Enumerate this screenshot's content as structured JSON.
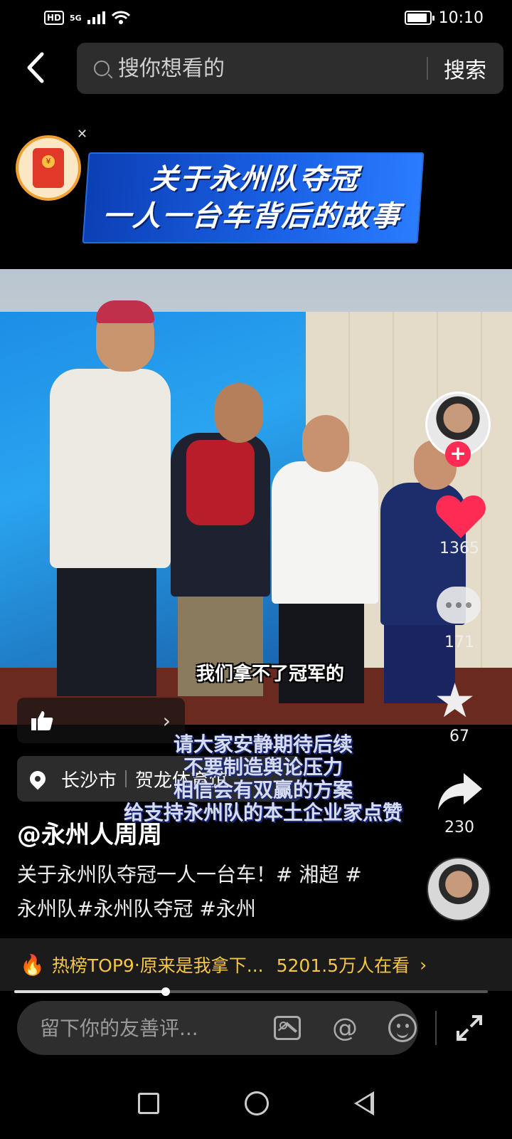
{
  "status_bar": {
    "hd": "HD",
    "network": "5G",
    "time": "10:10",
    "battery_level": 0.9
  },
  "search": {
    "placeholder": "搜你想看的",
    "button_label": "搜索"
  },
  "banner": {
    "line1": "关于永州队夺冠",
    "line2": "一人一台车背后的故事"
  },
  "video": {
    "subtitle_main": "我们拿不了冠军的",
    "subtitle_lines": [
      "请大家安静期待后续",
      "不要制造舆论压力",
      "相信会有双赢的方案",
      "给支持永州队的本土企业家点赞"
    ]
  },
  "actions": {
    "likes": "1365",
    "comments": "171",
    "favorites": "67",
    "shares": "230"
  },
  "location": {
    "city": "长沙市",
    "venue": "贺龙体育馆"
  },
  "post": {
    "author": "@永州人周周",
    "description": "关于永州队夺冠一人一台车！# 湘超 #永州队#永州队夺冠 #永州"
  },
  "hot": {
    "rank": "热榜TOP9",
    "dot": "·",
    "title": "原来是我拿下...",
    "viewers": "5201.5万人在看"
  },
  "progress": 0.32,
  "comment_input": {
    "placeholder": "留下你的友善评..."
  },
  "icons": {
    "back": "back-arrow-icon",
    "search": "search-icon",
    "redpacket": "red-envelope-icon",
    "like": "heart-icon",
    "comment": "comment-icon",
    "favorite": "star-icon",
    "share": "share-icon",
    "thumb": "thumbs-up-icon",
    "location": "location-pin-icon",
    "fire": "fire-icon",
    "image": "image-icon",
    "mention": "at-icon",
    "emoji": "emoji-icon",
    "expand": "expand-icon"
  },
  "colors": {
    "like": "#fe2c55",
    "hot": "#f5c646",
    "banner": "#1a62e6"
  }
}
